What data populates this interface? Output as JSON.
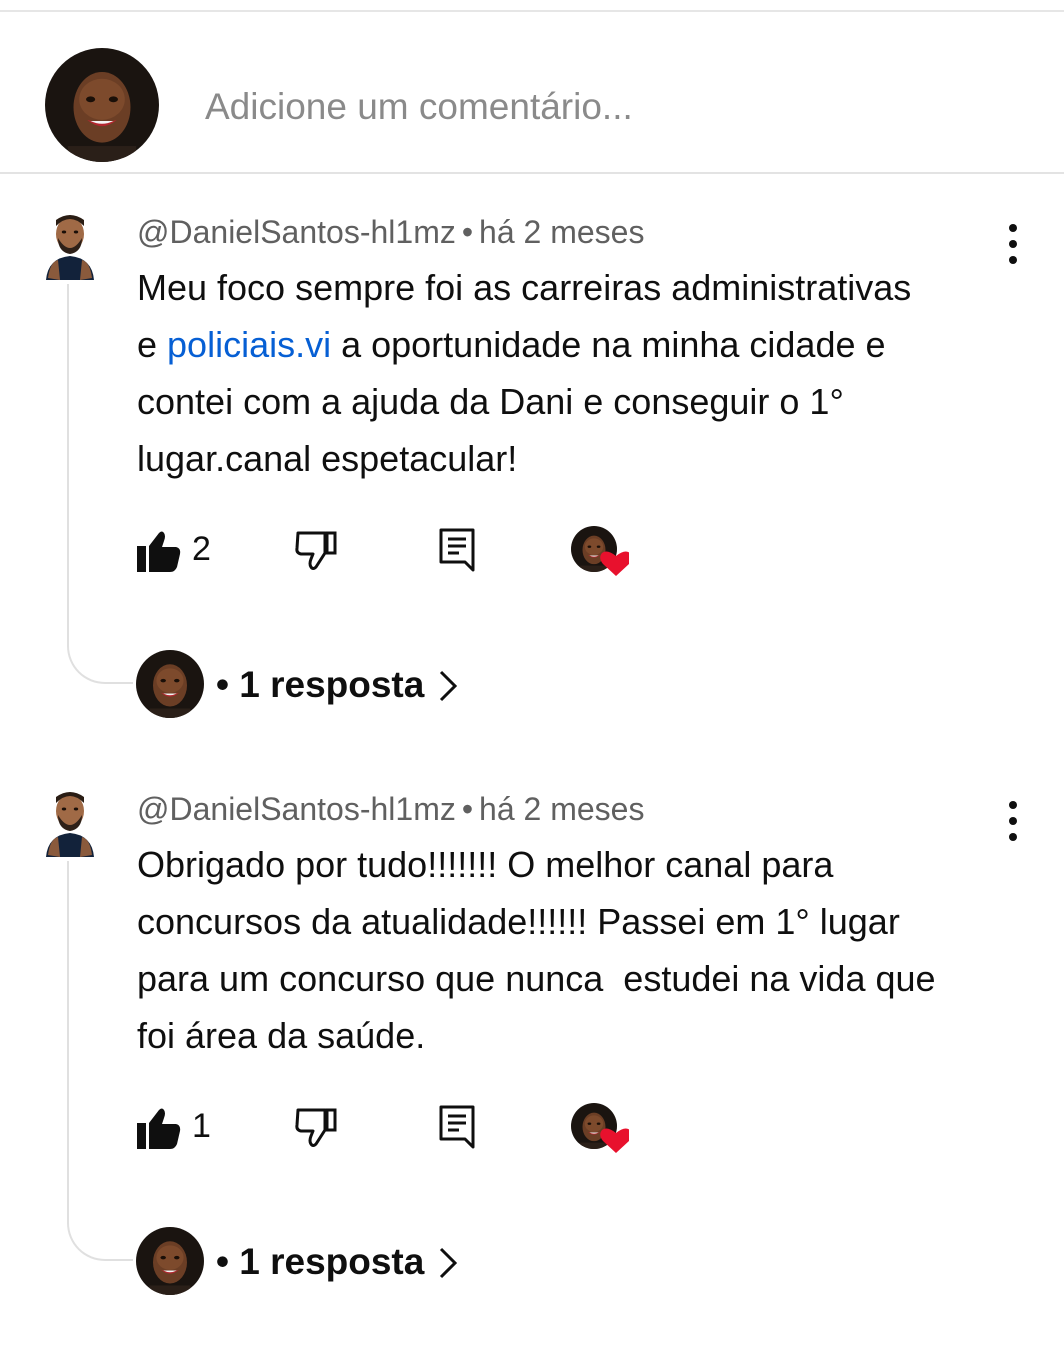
{
  "add_comment": {
    "placeholder": "Adicione um comentário..."
  },
  "comments": [
    {
      "author": "@DanielSantos-hl1mz",
      "separator": "•",
      "time": "há 2 meses",
      "text_before_link": "Meu foco sempre foi as carreiras administrativas\ne ",
      "link_text": "policiais.vi",
      "text_after_link": " a oportunidade na minha cidade e\ncontei com a ajuda da Dani e conseguir o 1°\nlugar.canal espetacular!",
      "like_count": "2",
      "replies_label": "• 1 resposta",
      "icons": [
        "like-icon",
        "dislike-icon",
        "reply-icon",
        "creator-heart-icon",
        "more-vert-icon",
        "chevron-right-icon"
      ]
    },
    {
      "author": "@DanielSantos-hl1mz",
      "separator": "•",
      "time": "há 2 meses",
      "text": "Obrigado por tudo!!!!!!! O melhor canal para\nconcursos da atualidade!!!!!! Passei em 1° lugar\npara um concurso que nunca  estudei na vida que\nfoi área da saúde.",
      "like_count": "1",
      "replies_label": "• 1 resposta",
      "icons": [
        "like-icon",
        "dislike-icon",
        "reply-icon",
        "creator-heart-icon",
        "more-vert-icon",
        "chevron-right-icon"
      ]
    }
  ],
  "colors": {
    "link": "#065fd4",
    "heart": "#e8112d",
    "meta_text": "#606060",
    "divider": "#e3e3e3"
  }
}
